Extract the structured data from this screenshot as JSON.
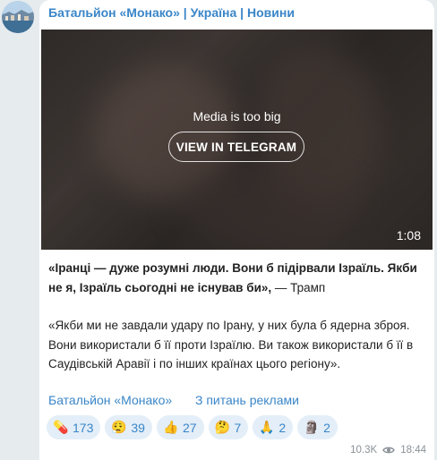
{
  "channel": {
    "title": "Батальйон «Монако» | Україна | Новини"
  },
  "media": {
    "message": "Media is too big",
    "button_label": "VIEW IN TELEGRAM",
    "duration": "1:08"
  },
  "post": {
    "quote1": "«Іранці — дуже розумні люди. Вони б підірвали Ізраїль. Якби не я, Ізраїль сьогодні не існував би»,",
    "attribution": " — Трамп",
    "quote2": "«Якби ми не завдали удару по Ірану, у них була б ядерна зброя. Вони використали б її проти Ізраїлю. Ви також використали б її в Саудівській Аравії і по інших країнах цього регіону»."
  },
  "footer": {
    "channel_link": "Батальйон «Монако»",
    "ads_link": "З питань реклами"
  },
  "reactions": [
    {
      "emoji": "💊",
      "icon": "pill-icon",
      "count": "173"
    },
    {
      "emoji": "😮‍💨",
      "icon": "face-exhaling-icon",
      "count": "39"
    },
    {
      "emoji": "👍",
      "icon": "thumbs-up-icon",
      "count": "27"
    },
    {
      "emoji": "🤔",
      "icon": "thinking-face-icon",
      "count": "7"
    },
    {
      "emoji": "🙏",
      "icon": "folded-hands-icon",
      "count": "2"
    },
    {
      "emoji": "🗿",
      "icon": "moai-icon",
      "count": "2"
    }
  ],
  "meta": {
    "views": "10.3K",
    "time": "18:44"
  },
  "colors": {
    "accent": "#3a86c8",
    "reaction_bg": "#e3eef8",
    "background": "#e6ebee"
  }
}
